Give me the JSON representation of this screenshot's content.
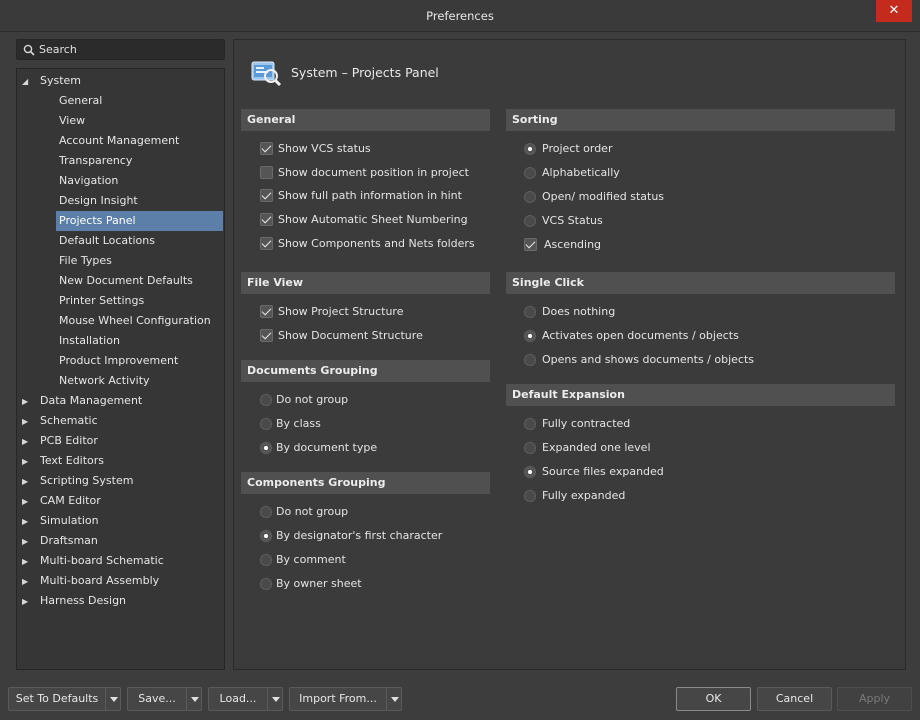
{
  "window": {
    "title": "Preferences",
    "close_glyph": "✕"
  },
  "search": {
    "placeholder": "Search"
  },
  "tree": {
    "system": "System",
    "system_children": [
      "General",
      "View",
      "Account Management",
      "Transparency",
      "Navigation",
      "Design Insight",
      "Projects Panel",
      "Default Locations",
      "File Types",
      "New Document Defaults",
      "Printer Settings",
      "Mouse Wheel Configuration",
      "Installation",
      "Product Improvement",
      "Network Activity"
    ],
    "selected": "Projects Panel",
    "collapsed": [
      "Data Management",
      "Schematic",
      "PCB Editor",
      "Text Editors",
      "Scripting System",
      "CAM Editor",
      "Simulation",
      "Draftsman",
      "Multi-board Schematic",
      "Multi-board Assembly",
      "Harness Design"
    ]
  },
  "page": {
    "title": "System – Projects Panel",
    "icon": "projects-panel-icon"
  },
  "general": {
    "title": "General",
    "options": [
      {
        "label": "Show VCS status",
        "checked": true
      },
      {
        "label": "Show document position in project",
        "checked": false
      },
      {
        "label": "Show full path information in hint",
        "checked": true
      },
      {
        "label": "Show Automatic Sheet Numbering",
        "checked": true
      },
      {
        "label": "Show Components and Nets folders",
        "checked": true
      }
    ]
  },
  "file_view": {
    "title": "File View",
    "options": [
      {
        "label": "Show Project Structure",
        "checked": true
      },
      {
        "label": "Show Document Structure",
        "checked": true
      }
    ]
  },
  "documents_grouping": {
    "title": "Documents Grouping",
    "options": [
      "Do not group",
      "By class",
      "By document type"
    ],
    "selected": "By document type"
  },
  "components_grouping": {
    "title": "Components Grouping",
    "options": [
      "Do not group",
      "By designator's first character",
      "By comment",
      "By owner sheet"
    ],
    "selected": "By designator's first character"
  },
  "sorting": {
    "title": "Sorting",
    "options": [
      "Project order",
      "Alphabetically",
      "Open/ modified status",
      "VCS Status"
    ],
    "selected": "Project order",
    "ascending": {
      "label": "Ascending",
      "checked": true
    }
  },
  "single_click": {
    "title": "Single Click",
    "options": [
      "Does nothing",
      "Activates open documents / objects",
      "Opens and shows documents / objects"
    ],
    "selected": "Activates open documents / objects"
  },
  "default_expansion": {
    "title": "Default Expansion",
    "options": [
      "Fully contracted",
      "Expanded one level",
      "Source files expanded",
      "Fully expanded"
    ],
    "selected": "Source files expanded"
  },
  "footer": {
    "set_to_defaults": "Set To Defaults",
    "save": "Save...",
    "load": "Load...",
    "import_from": "Import From...",
    "ok": "OK",
    "cancel": "Cancel",
    "apply": "Apply"
  }
}
